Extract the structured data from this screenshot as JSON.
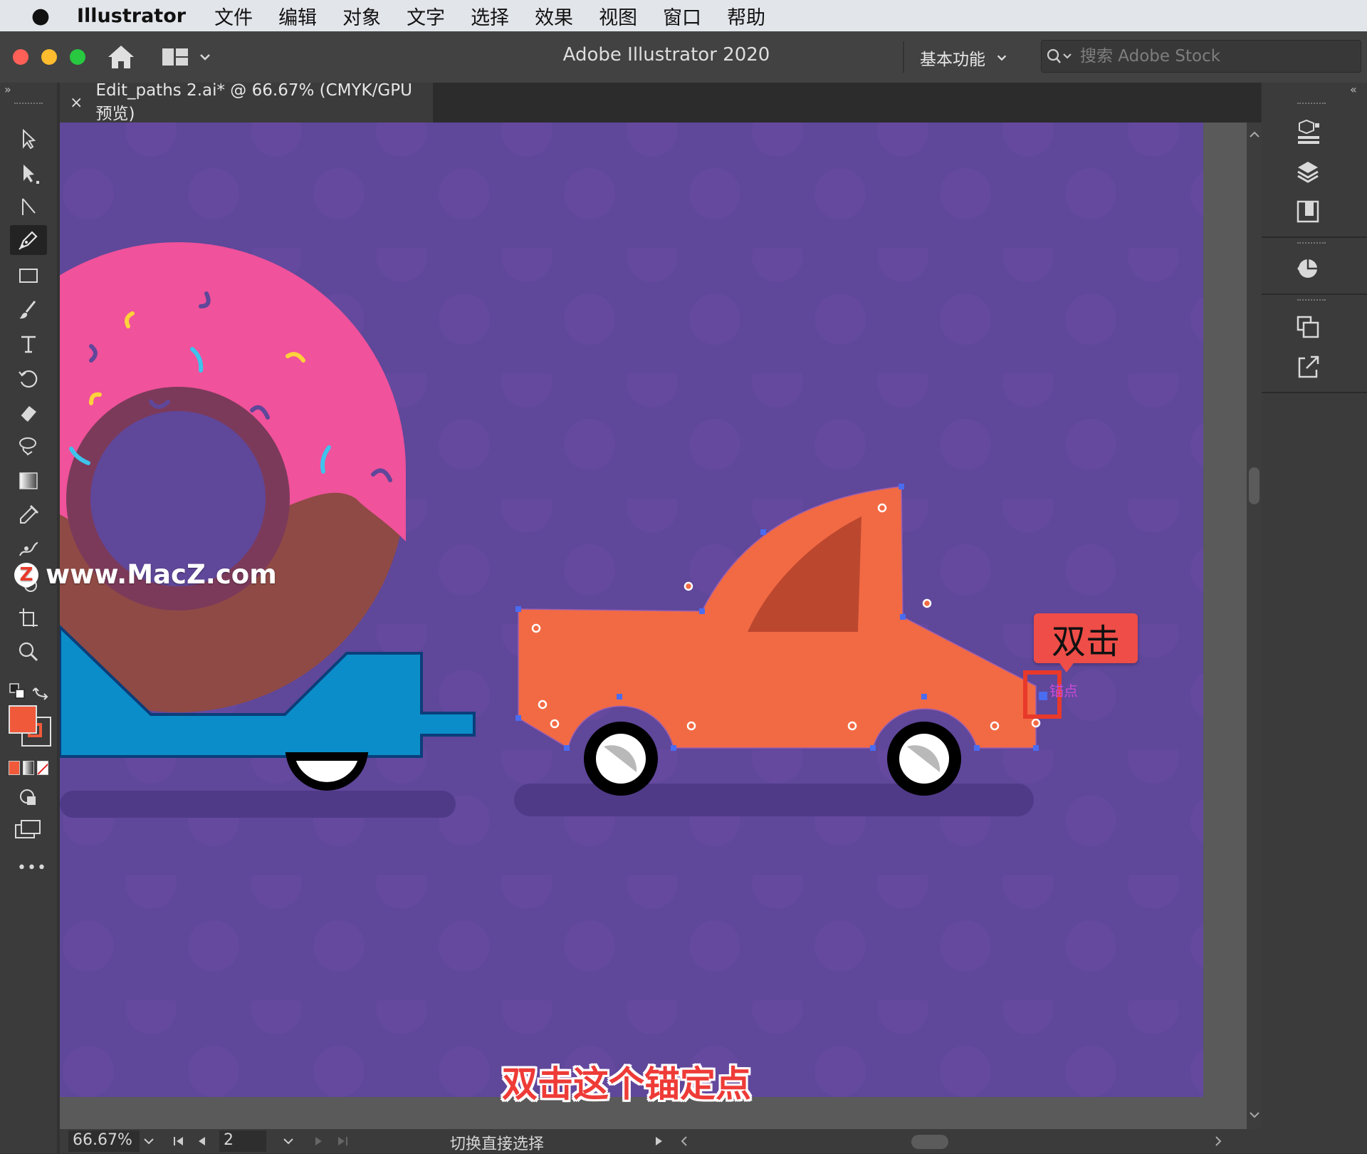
{
  "menubar": {
    "app_name": "Illustrator",
    "items": [
      "文件",
      "编辑",
      "对象",
      "文字",
      "选择",
      "效果",
      "视图",
      "窗口",
      "帮助"
    ]
  },
  "appbar": {
    "title": "Adobe Illustrator 2020",
    "workspace_label": "基本功能",
    "search_placeholder": "搜索 Adobe Stock"
  },
  "tab": {
    "label": "Edit_paths 2.ai* @ 66.67% (CMYK/GPU 预览)",
    "close": "×"
  },
  "toolbar": {
    "tools": [
      "selection-tool-icon",
      "direct-selection-tool-icon",
      "group-selection-tool-icon",
      "pen-tool-icon",
      "rectangle-tool-icon",
      "paintbrush-tool-icon",
      "type-tool-icon",
      "rotate-tool-icon",
      "eraser-tool-icon",
      "lasso-tool-icon",
      "gradient-tool-icon",
      "eyedropper-tool-icon",
      "puppet-warp-tool-icon",
      "shape-builder-tool-icon",
      "artboard-tool-icon",
      "zoom-tool-icon"
    ],
    "active_tool": "pen-tool-icon",
    "fill_color": "#f05a3a",
    "more_label": "•••"
  },
  "statusbar": {
    "zoom": "66.67%",
    "artboard_number": "2",
    "tool_hint": "切换直接选择"
  },
  "overlay": {
    "watermark": "www.MacZ.com",
    "watermark_badge": "Z",
    "callout": "双击",
    "anchor_hint": "锚点",
    "subtitle": "双击这个锚定点"
  },
  "colors": {
    "artboard": "#5f479a",
    "truck": "#f26a43",
    "trailer": "#0b8dc9",
    "donut_icing": "#f0529b",
    "donut_dough": "#8f4a45"
  }
}
